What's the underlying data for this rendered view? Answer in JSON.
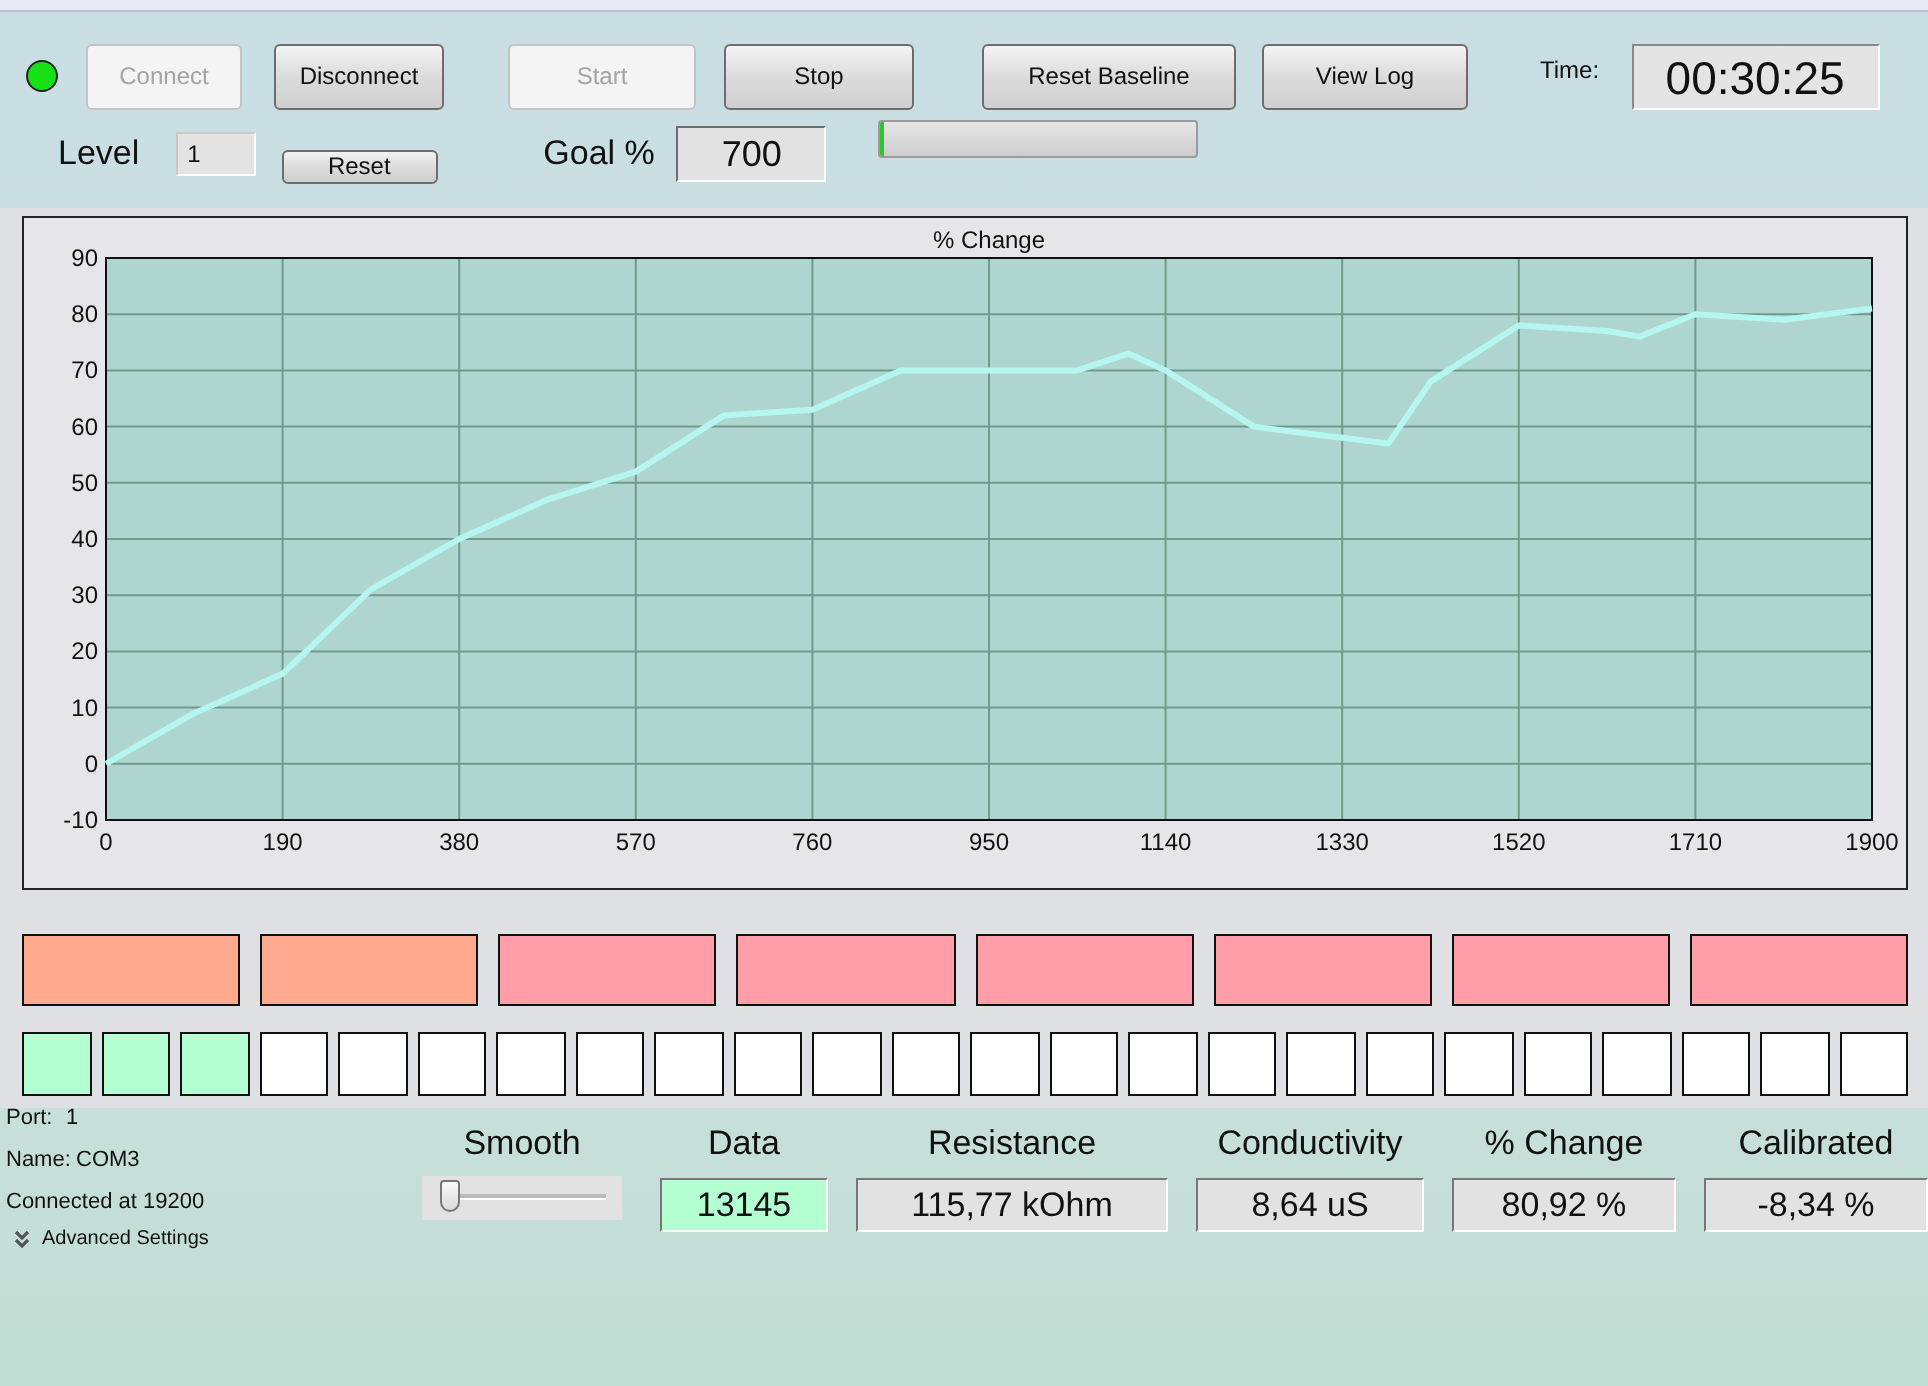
{
  "connection": {
    "connected": true
  },
  "toolbar": [
    {
      "label": "Connect",
      "disabled": true
    },
    {
      "label": "Disconnect",
      "disabled": false
    },
    {
      "label": "Start",
      "disabled": true
    },
    {
      "label": "Stop",
      "disabled": false
    },
    {
      "label": "Reset Baseline",
      "disabled": false
    },
    {
      "label": "View Log",
      "disabled": false
    }
  ],
  "time": {
    "label": "Time:",
    "value": "00:30:25"
  },
  "level": {
    "label": "Level",
    "value": "1",
    "reset": "Reset"
  },
  "goal": {
    "label": "Goal %",
    "value": "700",
    "level": 0.01
  },
  "chart": {
    "chart_data": {
      "type": "line",
      "title": "% Change",
      "x": [
        0,
        95,
        190,
        285,
        380,
        475,
        570,
        665,
        760,
        855,
        950,
        1045,
        1100,
        1140,
        1235,
        1280,
        1330,
        1380,
        1425,
        1520,
        1615,
        1650,
        1710,
        1805,
        1900
      ],
      "grid": true,
      "series": [
        {
          "color": "#b5f7f0",
          "values": [
            0,
            9,
            16,
            31,
            40,
            47,
            52,
            62,
            63,
            70,
            70,
            70,
            73,
            70,
            60,
            59,
            58,
            57,
            68,
            78,
            77,
            76,
            80,
            79,
            81
          ]
        }
      ],
      "xlim": [
        0,
        1900
      ],
      "ylim": [
        -10,
        90
      ],
      "xticks": [
        0,
        190,
        380,
        570,
        760,
        950,
        1140,
        1330,
        1520,
        1710,
        1900
      ],
      "yticks": [
        -10,
        0,
        10,
        20,
        30,
        40,
        50,
        60,
        70,
        80,
        90
      ]
    }
  },
  "blocks": [
    {
      "color": "#ffa98f"
    },
    {
      "color": "#ffa98f"
    },
    {
      "color": "#ff9da8"
    },
    {
      "color": "#ff9da8"
    },
    {
      "color": "#ff9da8"
    },
    {
      "color": "#ff9da8"
    },
    {
      "color": "#ff9da8"
    },
    {
      "color": "#ff9da8"
    }
  ],
  "squares": [
    {
      "color": "#b3ffd2"
    },
    {
      "color": "#b3ffd2"
    },
    {
      "color": "#b3ffd2"
    },
    {
      "color": "#ffffff"
    },
    {
      "color": "#ffffff"
    },
    {
      "color": "#ffffff"
    },
    {
      "color": "#ffffff"
    },
    {
      "color": "#ffffff"
    },
    {
      "color": "#ffffff"
    },
    {
      "color": "#ffffff"
    },
    {
      "color": "#ffffff"
    },
    {
      "color": "#ffffff"
    },
    {
      "color": "#ffffff"
    },
    {
      "color": "#ffffff"
    },
    {
      "color": "#ffffff"
    },
    {
      "color": "#ffffff"
    },
    {
      "color": "#ffffff"
    },
    {
      "color": "#ffffff"
    },
    {
      "color": "#ffffff"
    },
    {
      "color": "#ffffff"
    },
    {
      "color": "#ffffff"
    },
    {
      "color": "#ffffff"
    },
    {
      "color": "#ffffff"
    },
    {
      "color": "#ffffff"
    }
  ],
  "port_info": [
    {
      "label": "Port:",
      "value": "1"
    },
    {
      "label": "Name:",
      "value": "COM3"
    }
  ],
  "status": "Connected at 19200",
  "advanced_settings": "Advanced Settings",
  "smooth": {
    "label": "Smooth",
    "level": 0.05
  },
  "readouts": [
    {
      "label": "Data",
      "value": "13145",
      "highlighted": true
    },
    {
      "label": "Resistance",
      "value": "115,77 kOhm",
      "highlighted": false
    },
    {
      "label": "Conductivity",
      "value": "8,64 uS",
      "highlighted": false
    },
    {
      "label": "% Change",
      "value": "80,92 %",
      "highlighted": false
    },
    {
      "label": "Calibrated",
      "value": "-8,34 %",
      "highlighted": false
    }
  ]
}
